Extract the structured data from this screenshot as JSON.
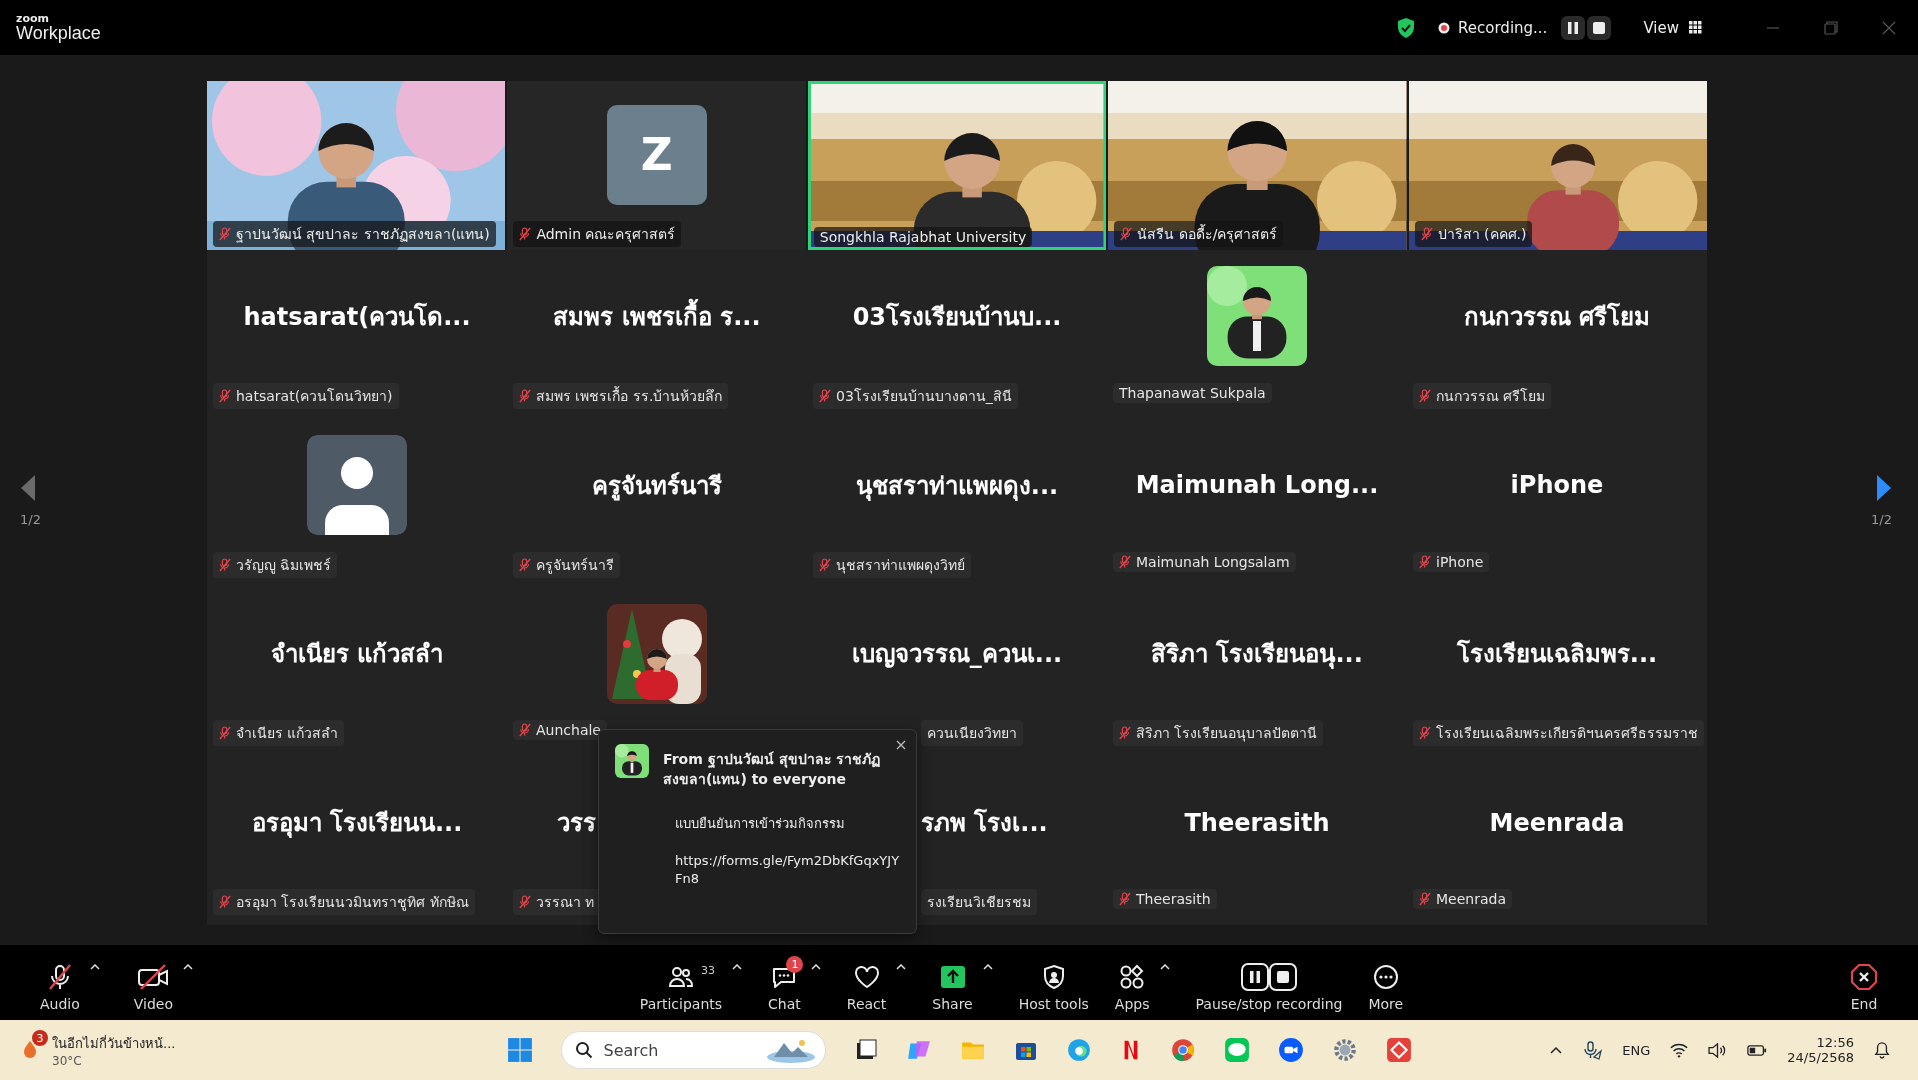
{
  "app": {
    "logo_top": "zoom",
    "logo_bottom": "Workplace"
  },
  "recording": {
    "label": "Recording..."
  },
  "view": {
    "label": "View"
  },
  "pager": {
    "previous": {
      "label": "1/2",
      "disabled": true
    },
    "next": {
      "label": "1/2",
      "disabled": false
    }
  },
  "video_row": [
    {
      "kind": "video",
      "label": "ฐาปนวัฒน์ สุขปาละ ราชภัฏสงขลา(แทน)",
      "muted": true,
      "speaking": false
    },
    {
      "kind": "initial",
      "initial": "Z",
      "label": "Admin คณะครุศาสตร์",
      "muted": true,
      "speaking": false
    },
    {
      "kind": "video",
      "label": "Songkhla Rajabhat University",
      "muted": false,
      "speaking": true
    },
    {
      "kind": "video",
      "label": "นัสรีน ดอดี้ะ/ครุศาสตร์",
      "muted": true,
      "speaking": false
    },
    {
      "kind": "video",
      "label": "ปาริสา (คคศ.)",
      "muted": true,
      "speaking": false
    }
  ],
  "gallery": [
    {
      "kind": "name",
      "name": "hatsarat(ควนโด...",
      "label": "hatsarat(ควนโดนวิทยา)",
      "muted": true
    },
    {
      "kind": "name",
      "name": "สมพร  เพชรเกื้อ  ร...",
      "label": "สมพร  เพชรเกื้อ รร.บ้านห้วยลึก",
      "muted": true
    },
    {
      "kind": "name",
      "name": "03โรงเรียนบ้านบ...",
      "label": "03โรงเรียนบ้านบางดาน_สินี",
      "muted": true
    },
    {
      "label": "Thapanawat Sukpala",
      "muted": false
    },
    {
      "kind": "name",
      "name": "กนกวรรณ ศรีโยม",
      "label": "กนกวรรณ ศรีโยม",
      "muted": true
    },
    {
      "kind": "default",
      "label": "วรัญญู ฉิมเพชร์",
      "muted": true
    },
    {
      "kind": "name",
      "name": "ครูจันทร์นารี",
      "label": "ครูจันทร์นารี",
      "muted": true
    },
    {
      "kind": "name",
      "name": "นุชสราท่าแพผดุง...",
      "label": "นุชสราท่าแพผดุงวิทย์",
      "muted": true
    },
    {
      "kind": "name",
      "name": "Maimunah  Long...",
      "label": "Maimunah Longsalam",
      "muted": true
    },
    {
      "kind": "name",
      "name": "iPhone",
      "label": "iPhone",
      "muted": true
    },
    {
      "kind": "name",
      "name": "จำเนียร  แก้วสลำ",
      "label": "จำเนียร  แก้วสลำ",
      "muted": true
    },
    {
      "label": "Aunchale",
      "muted": true
    },
    {
      "kind": "name",
      "name": "เบญจวรรณ_ควนเ...",
      "label": "ควนเนียงวิทยา",
      "muted": false,
      "label_cut_start": true
    },
    {
      "kind": "name",
      "name": "สิริภา โรงเรียนอนุ...",
      "label": "สิริภา โรงเรียนอนุบาลปัตตานี",
      "muted": true
    },
    {
      "kind": "name",
      "name": "โรงเรียนเฉลิมพร...",
      "label": "โรงเรียนเฉลิมพระเกียรติฯนครศรีธรรมราช",
      "muted": true
    },
    {
      "kind": "name",
      "name": "อรอุมา โรงเรียนน...",
      "label": "อรอุมา โรงเรียนนวมินทราชูทิศ ทักษิณ",
      "muted": true
    },
    {
      "kind": "name",
      "name": "วรร",
      "label": "วรรณา ท",
      "muted": true,
      "name_cut_end": true
    },
    {
      "kind": "name",
      "name": "รภพ  โรงเ...",
      "label": "รงเรียนวิเชียรชม",
      "muted": false,
      "name_cut_start": true,
      "label_cut_start": true
    },
    {
      "kind": "name",
      "name": "Theerasith",
      "label": "Theerasith",
      "muted": true
    },
    {
      "kind": "name",
      "name": "Meenrada",
      "label": "Meenrada",
      "muted": true
    }
  ],
  "chat_popup": {
    "header": "From ฐาปนวัฒน์ สุขปาละ ราชภัฏสงขลา(แทน) to everyone",
    "message": "แบบยืนยันการเข้าร่วมกิจกรรม",
    "link": "https://forms.gle/Fym2DbKfGqxYJYFn8"
  },
  "toolbar": [
    {
      "kind": "audio",
      "label": "Audio",
      "off": true,
      "caret": true
    },
    {
      "kind": "video",
      "label": "Video",
      "off": true,
      "caret": true
    },
    {
      "kind": "participants",
      "label": "Participants",
      "count": "33",
      "caret": true
    },
    {
      "kind": "chat",
      "label": "Chat",
      "badge": "1",
      "caret": true
    },
    {
      "kind": "react",
      "label": "React",
      "caret": true
    },
    {
      "kind": "share",
      "label": "Share",
      "caret": true
    },
    {
      "kind": "host",
      "label": "Host tools",
      "caret": false
    },
    {
      "kind": "apps",
      "label": "Apps",
      "caret": true
    },
    {
      "kind": "recording",
      "label": "Pause/stop recording",
      "caret": false
    },
    {
      "kind": "more",
      "label": "More",
      "caret": false
    },
    {
      "kind": "end",
      "label": "End",
      "caret": false
    }
  ],
  "taskbar": {
    "weather_text": "ในอีกไม่กี่วันข้างหน้...",
    "temperature": "30°C",
    "weather_badge": "3",
    "search_placeholder": "Search",
    "language": "ENG",
    "time": "12:56",
    "date": "24/5/2568"
  }
}
